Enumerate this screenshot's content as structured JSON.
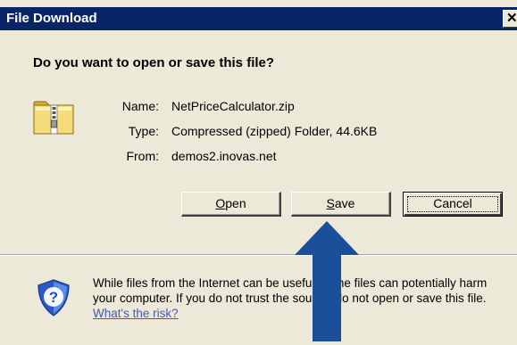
{
  "window": {
    "title": "File Download",
    "close_glyph": "✕",
    "close_icon": "close-icon"
  },
  "question": "Do you want to open or save this file?",
  "file": {
    "icon": "zip-folder-icon",
    "name_label": "Name:",
    "name": "NetPriceCalculator.zip",
    "type_label": "Type:",
    "type": "Compressed (zipped) Folder, 44.6KB",
    "from_label": "From:",
    "from": "demos2.inovas.net"
  },
  "buttons": {
    "open_mnemonic": "O",
    "open_rest": "pen",
    "save_mnemonic": "S",
    "save_rest": "ave",
    "cancel": "Cancel"
  },
  "warning": {
    "icon": "security-shield-icon",
    "text": "While files from the Internet can be useful, some files can potentially harm your computer. If you do not trust the source, do not open or save this file. ",
    "link": "What's the risk?"
  },
  "annotation": {
    "icon": "up-arrow",
    "color": "#1b4f99"
  },
  "colors": {
    "titlebar": "#0a2468",
    "dialog": "#ece9d8",
    "link": "#4a57b8"
  }
}
